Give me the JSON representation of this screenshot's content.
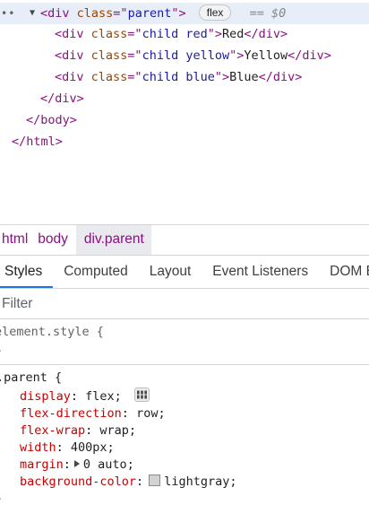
{
  "dom_tree": {
    "ellipsis": "••",
    "expand_caret": "▼",
    "parent_line": {
      "open": "<div",
      "attr_name": "class",
      "eq_quote": "=\"",
      "attr_value": "parent",
      "close_quote": "\">",
      "badge": "flex",
      "dollar": "== $0"
    },
    "children": [
      {
        "open": "<div",
        "attr_name": "class",
        "attr_value": "child red",
        "text": "Red",
        "close": "</div>"
      },
      {
        "open": "<div",
        "attr_name": "class",
        "attr_value": "child yellow",
        "text": "Yellow",
        "close": "</div>"
      },
      {
        "open": "<div",
        "attr_name": "class",
        "attr_value": "child blue",
        "text": "Blue",
        "close": "</div>"
      }
    ],
    "closing": [
      "</div>",
      "</body>",
      "</html>"
    ]
  },
  "breadcrumb": [
    "html",
    "body",
    "div.parent"
  ],
  "tabs": [
    "Styles",
    "Computed",
    "Layout",
    "Event Listeners",
    "DOM Breakpoints"
  ],
  "filter": {
    "placeholder": "Filter",
    "value": ""
  },
  "styles": {
    "element_style": {
      "selector": "element.style {",
      "close": "}"
    },
    "parent_rule": {
      "selector": ".parent {",
      "close": "}",
      "declarations": [
        {
          "name": "display",
          "value": "flex;"
        },
        {
          "name": "flex-direction",
          "value": "row;"
        },
        {
          "name": "flex-wrap",
          "value": "wrap;"
        },
        {
          "name": "width",
          "value": "400px;"
        },
        {
          "name": "margin",
          "value": "0 auto;"
        },
        {
          "name": "background-color",
          "value": "lightgray;"
        }
      ]
    },
    "swatch_color": "#d3d3d3"
  },
  "colors": {
    "tag": "#881280",
    "attr_name": "#994500",
    "attr_value": "#1a1aa6",
    "css_property": "#c80000",
    "tab_underline": "#1a73e8",
    "selected_row": "#e8eef7"
  }
}
